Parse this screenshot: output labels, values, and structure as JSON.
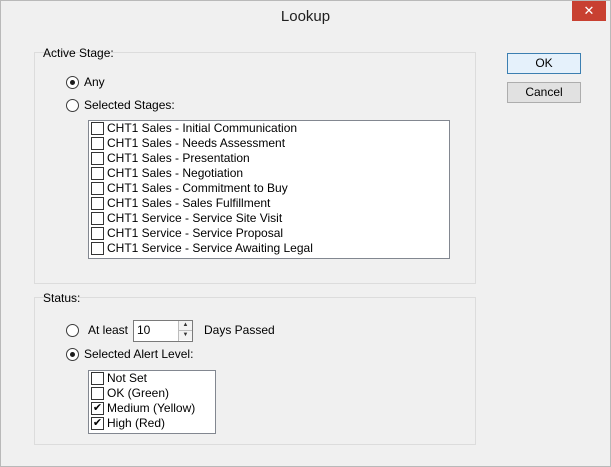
{
  "window": {
    "title": "Lookup",
    "close_glyph": "✕"
  },
  "buttons": {
    "ok": "OK",
    "cancel": "Cancel"
  },
  "active_stage": {
    "label": "Active Stage:",
    "any_label": "Any",
    "selected_label": "Selected Stages:",
    "selected_option": "any",
    "stages": [
      "CHT1 Sales - Initial Communication",
      "CHT1 Sales - Needs Assessment",
      "CHT1 Sales - Presentation",
      "CHT1 Sales - Negotiation",
      "CHT1 Sales - Commitment to Buy",
      "CHT1 Sales - Sales Fulfillment",
      "CHT1 Service - Service Site Visit",
      "CHT1 Service - Service Proposal",
      "CHT1 Service - Service Awaiting Legal"
    ]
  },
  "status": {
    "label": "Status:",
    "at_least_label": "At least",
    "days_value": "10",
    "days_suffix": "Days Passed",
    "selected_alert_label": "Selected Alert Level:",
    "selected_option": "alert",
    "alert_levels": [
      {
        "label": "Not Set",
        "checked": false
      },
      {
        "label": "OK (Green)",
        "checked": false
      },
      {
        "label": "Medium (Yellow)",
        "checked": true
      },
      {
        "label": "High (Red)",
        "checked": true
      }
    ],
    "spin_up_glyph": "▲",
    "spin_down_glyph": "▼"
  },
  "check_glyph": "✔"
}
